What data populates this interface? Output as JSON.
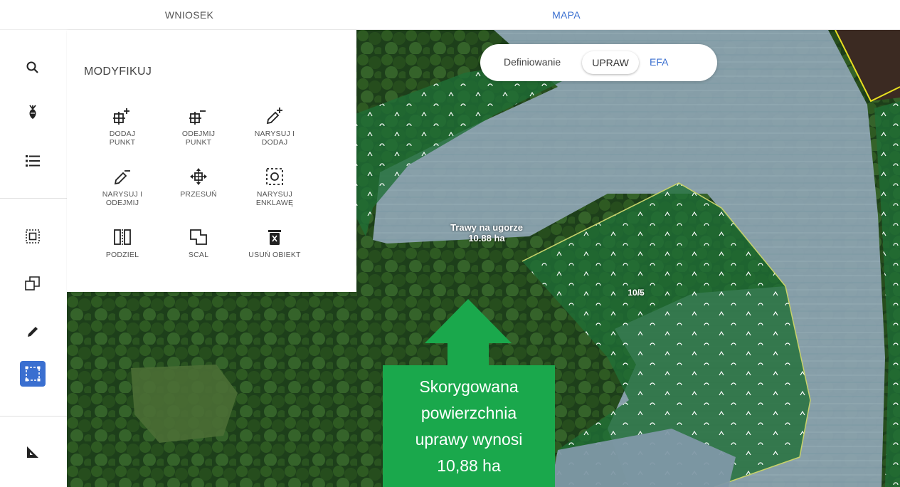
{
  "tabs": [
    {
      "label": "WNIOSEK",
      "active": false
    },
    {
      "label": "MAPA",
      "active": true
    }
  ],
  "rail_icons": [
    "search-icon",
    "crop-icon",
    "list-icon",
    "select-area-icon",
    "copy-shape-icon",
    "pencil-icon",
    "modify-shape-icon",
    "measure-icon"
  ],
  "panel": {
    "title": "MODYFIKUJ",
    "tools": [
      {
        "label": "DODAJ\nPUNKT",
        "icon": "add-point-icon"
      },
      {
        "label": "ODEJMIJ\nPUNKT",
        "icon": "remove-point-icon"
      },
      {
        "label": "NARYSUJ I\nDODAJ",
        "icon": "draw-add-icon"
      },
      {
        "label": "NARYSUJ I\nODEJMIJ",
        "icon": "draw-subtract-icon"
      },
      {
        "label": "PRZESUŃ",
        "icon": "move-icon"
      },
      {
        "label": "NARYSUJ\nENKLAWĘ",
        "icon": "enclave-icon"
      },
      {
        "label": "PODZIEL",
        "icon": "split-icon"
      },
      {
        "label": "SCAL",
        "icon": "merge-icon"
      },
      {
        "label": "USUŃ OBIEKT",
        "icon": "delete-object-icon"
      }
    ]
  },
  "toggle": {
    "label": "Definiowanie",
    "option_selected": "UPRAW",
    "option_other": "EFA"
  },
  "map": {
    "parcel_label_line1": "Trawy na ugorze",
    "parcel_label_line2": "10.88 ha",
    "plot_label": "10/5"
  },
  "callout": {
    "text": "Skorygowana\npowierzchnia\nuprawy wynosi\n10,88 ha"
  },
  "colors": {
    "accent": "#3a6fd0",
    "callout": "#1aa84c",
    "field": "#8da4b4",
    "forest_overlay": "#1f6e36"
  }
}
